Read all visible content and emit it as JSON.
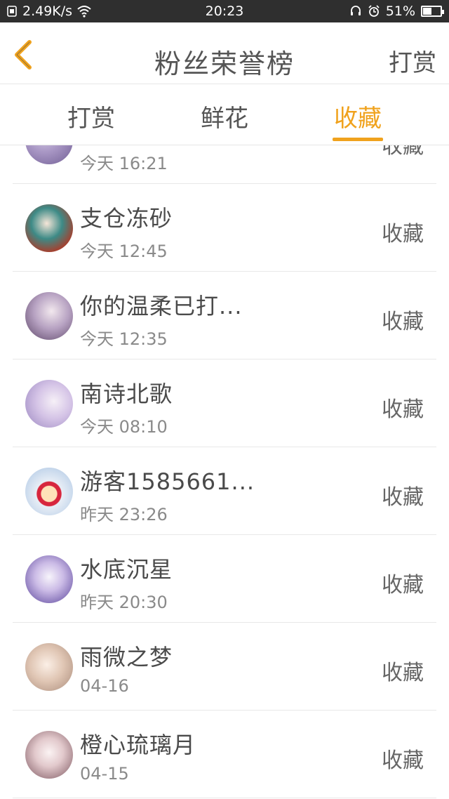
{
  "statusbar": {
    "net_speed": "2.49K/s",
    "time": "20:23",
    "battery_percent": "51%",
    "battery_level": 0.51
  },
  "header": {
    "title": "粉丝荣誉榜",
    "action_label": "打赏"
  },
  "tabs": [
    {
      "label": "打赏",
      "active": false
    },
    {
      "label": "鲜花",
      "active": false
    },
    {
      "label": "收藏",
      "active": true
    }
  ],
  "colors": {
    "accent": "#f0a21d",
    "statusbar_bg": "#2f2f2f"
  },
  "list": {
    "items": [
      {
        "name": "",
        "time": "今天 16:21",
        "tag": "收藏"
      },
      {
        "name": "支仓冻砂",
        "time": "今天 12:45",
        "tag": "收藏"
      },
      {
        "name": "你的温柔已打...",
        "time": "今天 12:35",
        "tag": "收藏"
      },
      {
        "name": "南诗北歌",
        "time": "今天 08:10",
        "tag": "收藏"
      },
      {
        "name": "游客1585661...",
        "time": "昨天 23:26",
        "tag": "收藏"
      },
      {
        "name": "水底沉星",
        "time": "昨天 20:30",
        "tag": "收藏"
      },
      {
        "name": "雨微之梦",
        "time": "04-16",
        "tag": "收藏"
      },
      {
        "name": "橙心琉璃月",
        "time": "04-15",
        "tag": "收藏"
      }
    ]
  }
}
